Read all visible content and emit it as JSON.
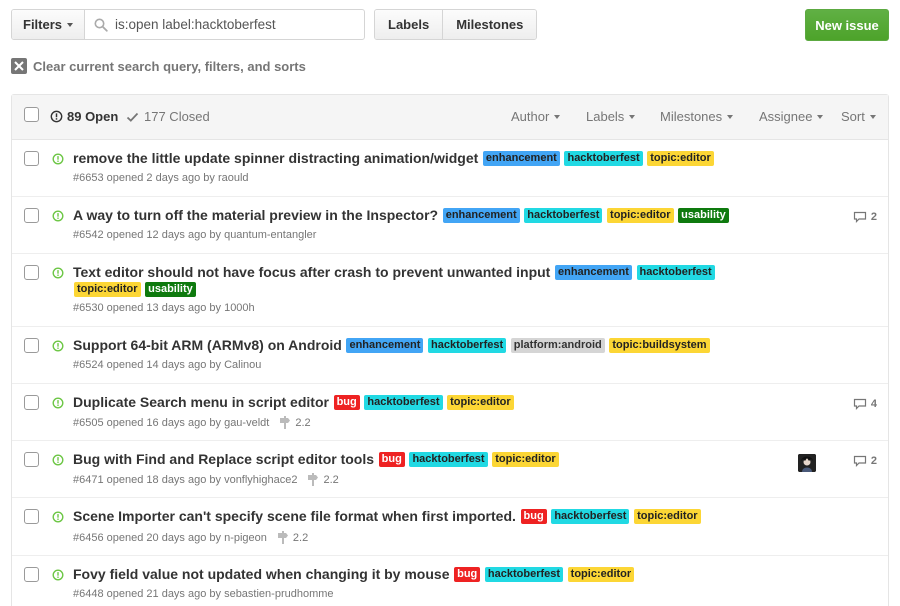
{
  "toolbar": {
    "filters_label": "Filters",
    "search_value": "is:open label:hacktoberfest",
    "labels_btn": "Labels",
    "milestones_btn": "Milestones",
    "new_issue_btn": "New issue",
    "clear_text": "Clear current search query, filters, and sorts"
  },
  "header": {
    "open_count": "89 Open",
    "closed_count": "177 Closed",
    "menus": {
      "author": "Author",
      "labels": "Labels",
      "milestones": "Milestones",
      "assignee": "Assignee",
      "sort": "Sort"
    }
  },
  "colors": {
    "accent_green": "#6cc644",
    "new_issue_green": "#55a532",
    "enhancement": "#42a5f5",
    "hacktoberfest": "#21d9e3",
    "topic": "#fcd635",
    "usability": "#0e7a0e",
    "bug": "#ee2222",
    "platform": "#d5d5d5"
  },
  "issues": [
    {
      "title": "remove the little update spinner distracting animation/widget",
      "labels": [
        {
          "text": "enhancement",
          "bg": "#42a5f5",
          "fg": "#222"
        },
        {
          "text": "hacktoberfest",
          "bg": "#21d9e3",
          "fg": "#222"
        },
        {
          "text": "topic:editor",
          "bg": "#fcd635",
          "fg": "#222"
        }
      ],
      "meta": "#6653 opened 2 days ago by raould",
      "milestone": "",
      "comments": ""
    },
    {
      "title": "A way to turn off the material preview in the Inspector?",
      "labels": [
        {
          "text": "enhancement",
          "bg": "#42a5f5",
          "fg": "#222"
        },
        {
          "text": "hacktoberfest",
          "bg": "#21d9e3",
          "fg": "#222"
        },
        {
          "text": "topic:editor",
          "bg": "#fcd635",
          "fg": "#222"
        },
        {
          "text": "usability",
          "bg": "#0e7a0e",
          "fg": "#fff"
        }
      ],
      "meta": "#6542 opened 12 days ago by quantum-entangler",
      "milestone": "",
      "comments": "2"
    },
    {
      "title": "Text editor should not have focus after crash to prevent unwanted input",
      "labels": [
        {
          "text": "enhancement",
          "bg": "#42a5f5",
          "fg": "#222"
        },
        {
          "text": "hacktoberfest",
          "bg": "#21d9e3",
          "fg": "#222"
        },
        {
          "text": "topic:editor",
          "bg": "#fcd635",
          "fg": "#222"
        },
        {
          "text": "usability",
          "bg": "#0e7a0e",
          "fg": "#fff"
        }
      ],
      "meta": "#6530 opened 13 days ago by 1000h",
      "milestone": "",
      "comments": ""
    },
    {
      "title": "Support 64-bit ARM (ARMv8) on Android",
      "labels": [
        {
          "text": "enhancement",
          "bg": "#42a5f5",
          "fg": "#222"
        },
        {
          "text": "hacktoberfest",
          "bg": "#21d9e3",
          "fg": "#222"
        },
        {
          "text": "platform:android",
          "bg": "#d5d5d5",
          "fg": "#333"
        },
        {
          "text": "topic:buildsystem",
          "bg": "#fcd635",
          "fg": "#222"
        }
      ],
      "meta": "#6524 opened 14 days ago by Calinou",
      "milestone": "",
      "comments": ""
    },
    {
      "title": "Duplicate Search menu in script editor",
      "labels": [
        {
          "text": "bug",
          "bg": "#ee2222",
          "fg": "#fff"
        },
        {
          "text": "hacktoberfest",
          "bg": "#21d9e3",
          "fg": "#222"
        },
        {
          "text": "topic:editor",
          "bg": "#fcd635",
          "fg": "#222"
        }
      ],
      "meta": "#6505 opened 16 days ago by gau-veldt",
      "milestone": "2.2",
      "comments": "4"
    },
    {
      "title": "Bug with Find and Replace script editor tools",
      "labels": [
        {
          "text": "bug",
          "bg": "#ee2222",
          "fg": "#fff"
        },
        {
          "text": "hacktoberfest",
          "bg": "#21d9e3",
          "fg": "#222"
        },
        {
          "text": "topic:editor",
          "bg": "#fcd635",
          "fg": "#222"
        }
      ],
      "meta": "#6471 opened 18 days ago by vonflyhighace2",
      "milestone": "2.2",
      "comments": "2",
      "avatar": true
    },
    {
      "title": "Scene Importer can't specify scene file format when first imported.",
      "labels": [
        {
          "text": "bug",
          "bg": "#ee2222",
          "fg": "#fff"
        },
        {
          "text": "hacktoberfest",
          "bg": "#21d9e3",
          "fg": "#222"
        },
        {
          "text": "topic:editor",
          "bg": "#fcd635",
          "fg": "#222"
        }
      ],
      "meta": "#6456 opened 20 days ago by n-pigeon",
      "milestone": "2.2",
      "comments": ""
    },
    {
      "title": "Fovy field value not updated when changing it by mouse",
      "labels": [
        {
          "text": "bug",
          "bg": "#ee2222",
          "fg": "#fff"
        },
        {
          "text": "hacktoberfest",
          "bg": "#21d9e3",
          "fg": "#222"
        },
        {
          "text": "topic:editor",
          "bg": "#fcd635",
          "fg": "#222"
        }
      ],
      "meta": "#6448 opened 21 days ago by sebastien-prudhomme",
      "milestone": "",
      "comments": ""
    }
  ]
}
